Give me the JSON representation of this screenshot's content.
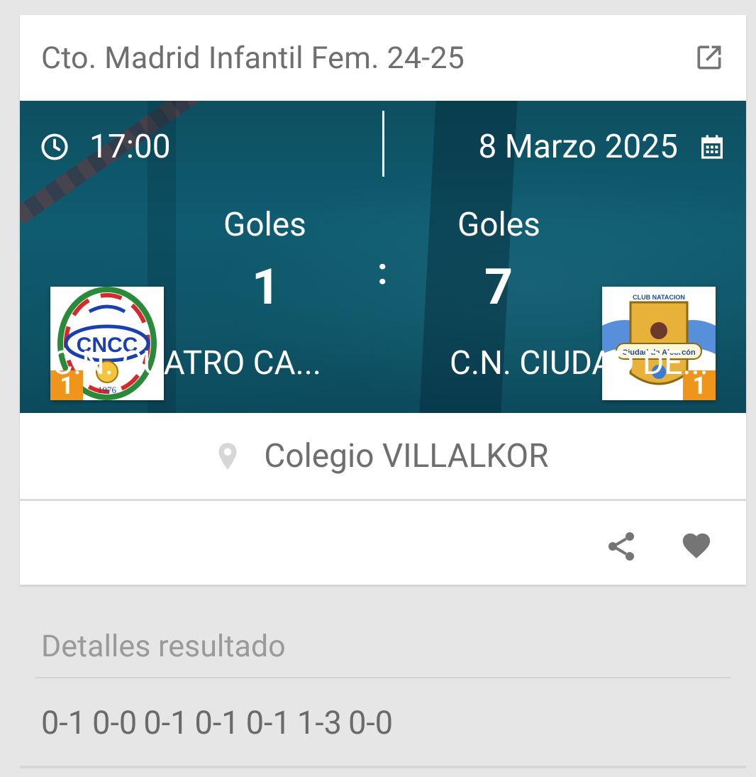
{
  "header": {
    "competition": "Cto. Madrid Infantil Fem. 24-25",
    "open_icon": "open-in-new-icon"
  },
  "match": {
    "time": "17:00",
    "date": "8 Marzo 2025",
    "separator": ":",
    "home": {
      "goals_label": "Goles",
      "score": "1",
      "name": "C.N. CUATRO CA...",
      "badge": "1",
      "logo_text": "CNCC",
      "logo_year": "1976"
    },
    "away": {
      "goals_label": "Goles",
      "score": "7",
      "name": "C.N. CIUDAD DE...",
      "badge": "1",
      "logo_text": "Ciudad de Alcorcón",
      "logo_top": "CLUB NATACION"
    }
  },
  "venue": {
    "name": "Colegio VILLALKOR",
    "icon": "location-pin-icon"
  },
  "actions": {
    "share_icon": "share-icon",
    "favorite_icon": "heart-icon"
  },
  "details": {
    "title": "Detalles resultado",
    "quarters": "0-1 0-0 0-1 0-1 0-1 1-3 0-0"
  },
  "colors": {
    "badge": "#f0951c",
    "hero": "#0f5c70"
  }
}
